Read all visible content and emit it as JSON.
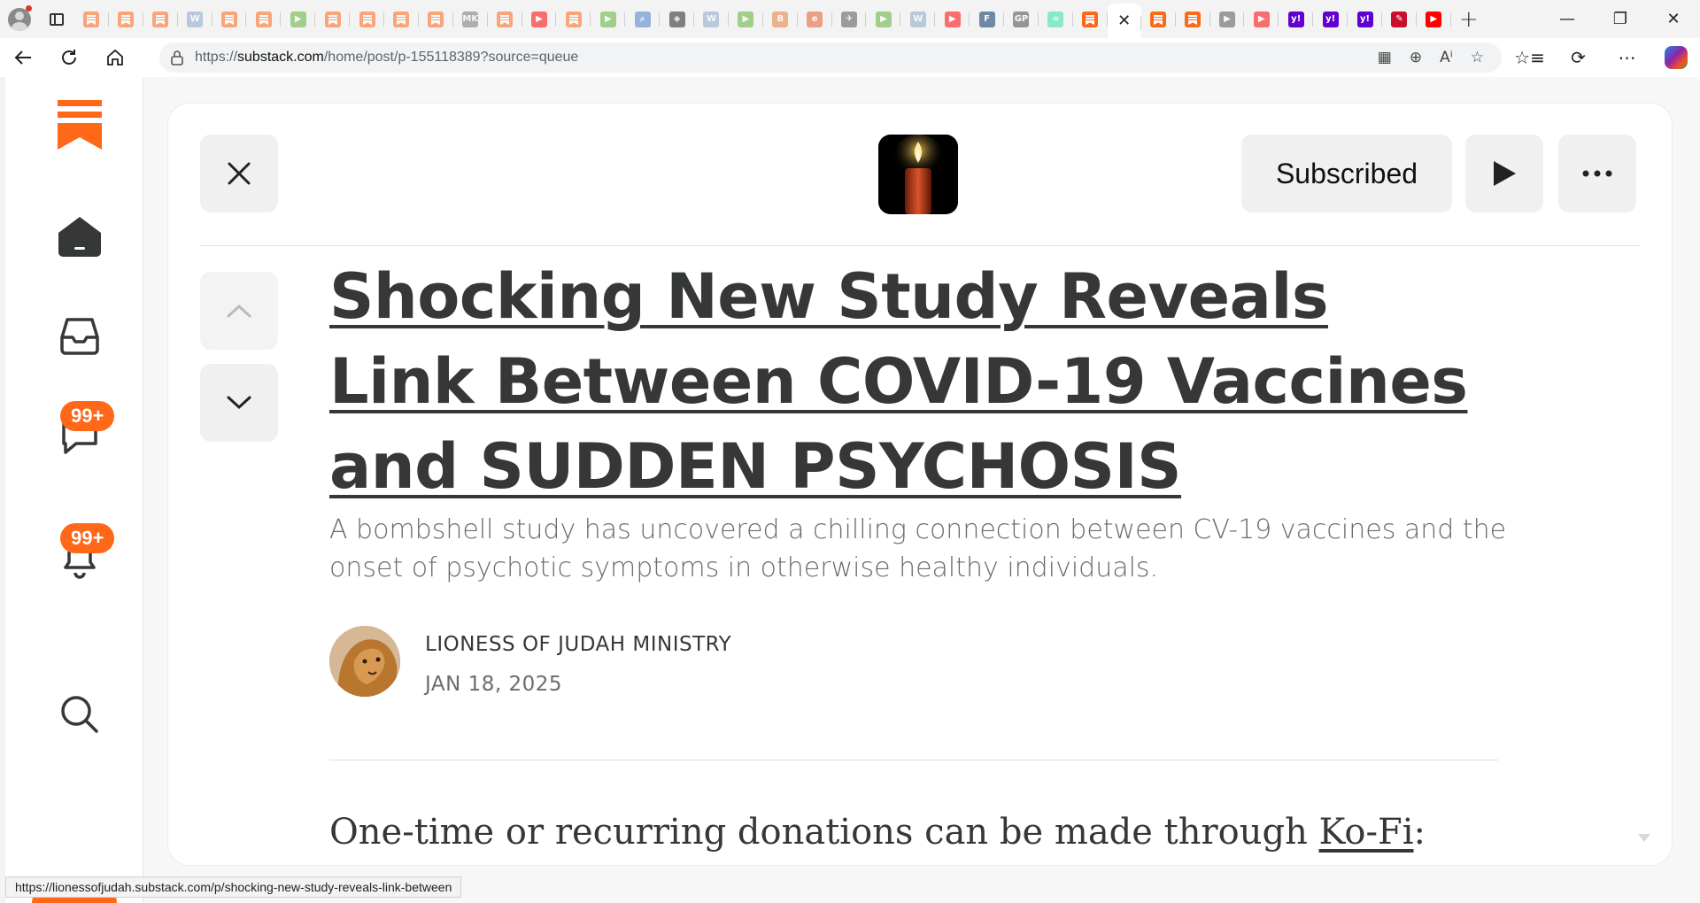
{
  "browser": {
    "tabs": [
      {
        "icon": "substack-icon",
        "color": "#ff6719",
        "glyph": ""
      },
      {
        "icon": "substack-icon",
        "color": "#ff6719",
        "glyph": ""
      },
      {
        "icon": "substack-icon",
        "color": "#ff6719",
        "glyph": ""
      },
      {
        "icon": "wikipedia-icon",
        "color": "#8aa6c8",
        "glyph": "W"
      },
      {
        "icon": "substack-icon",
        "color": "#ff6719",
        "glyph": ""
      },
      {
        "icon": "substack-icon",
        "color": "#ff6719",
        "glyph": ""
      },
      {
        "icon": "rumble-icon",
        "color": "#5cb335",
        "glyph": "▶"
      },
      {
        "icon": "substack-icon",
        "color": "#ff6719",
        "glyph": ""
      },
      {
        "icon": "substack-icon",
        "color": "#ff6719",
        "glyph": ""
      },
      {
        "icon": "substack-icon",
        "color": "#ff6719",
        "glyph": ""
      },
      {
        "icon": "substack-icon",
        "color": "#ff6719",
        "glyph": ""
      },
      {
        "icon": "mk-icon",
        "color": "#777777",
        "glyph": "MK"
      },
      {
        "icon": "substack-icon",
        "color": "#ff6719",
        "glyph": ""
      },
      {
        "icon": "youtube-icon",
        "color": "#ff0000",
        "glyph": "▶"
      },
      {
        "icon": "substack-icon",
        "color": "#ff6719",
        "glyph": ""
      },
      {
        "icon": "rumble-icon",
        "color": "#5cb335",
        "glyph": "▶"
      },
      {
        "icon": "search-icon",
        "color": "#4a7fc4",
        "glyph": "⌕"
      },
      {
        "icon": "navigation-icon",
        "color": "#222222",
        "glyph": "◈"
      },
      {
        "icon": "wikipedia-icon",
        "color": "#8aa6c8",
        "glyph": "W"
      },
      {
        "icon": "rumble-icon",
        "color": "#5cb335",
        "glyph": "▶"
      },
      {
        "icon": "bookmark-icon",
        "color": "#e57c3a",
        "glyph": "B"
      },
      {
        "icon": "edge-e-icon",
        "color": "#e55b2b",
        "glyph": "e"
      },
      {
        "icon": "bird-icon",
        "color": "#555555",
        "glyph": "✈"
      },
      {
        "icon": "rumble-icon",
        "color": "#5cb335",
        "glyph": "▶"
      },
      {
        "icon": "wikipedia-icon",
        "color": "#8aa6c8",
        "glyph": "W"
      },
      {
        "icon": "youtube-icon",
        "color": "#ff0000",
        "glyph": "▶"
      },
      {
        "icon": "fox-news-icon",
        "color": "#003366",
        "glyph": "F"
      },
      {
        "icon": "gp-icon",
        "color": "#4a4a4a",
        "glyph": "GP"
      },
      {
        "icon": "tripadvisor-icon",
        "color": "#34e0a1",
        "glyph": "∞"
      },
      {
        "icon": "substack-icon",
        "color": "#ff6719",
        "glyph": "",
        "bright": true
      },
      {
        "icon": "close-icon",
        "color": "",
        "glyph": "✕",
        "active": true
      },
      {
        "icon": "substack-icon",
        "color": "#ff6719",
        "glyph": "",
        "bright": true
      },
      {
        "icon": "substack-icon",
        "color": "#ff6719",
        "glyph": "",
        "bright": true
      },
      {
        "icon": "forward-tag-icon",
        "color": "#555555",
        "glyph": "▶"
      },
      {
        "icon": "youtube-icon",
        "color": "#ff0000",
        "glyph": "▶"
      },
      {
        "icon": "yahoo-icon",
        "color": "#6001d2",
        "glyph": "y!",
        "bright": true
      },
      {
        "icon": "yahoo-icon",
        "color": "#6001d2",
        "glyph": "y!",
        "bright": true
      },
      {
        "icon": "yahoo-icon",
        "color": "#6001d2",
        "glyph": "y!",
        "bright": true
      },
      {
        "icon": "pen-icon",
        "color": "#c8102e",
        "glyph": "✎",
        "bright": true
      },
      {
        "icon": "youtube-icon",
        "color": "#ff0000",
        "glyph": "▶",
        "bright": true
      }
    ],
    "url_prefix": "https://",
    "url_domain": "substack.com",
    "url_path": "/home/post/p-155118389?source=queue",
    "status_url": "https://lionessofjudah.substack.com/p/shocking-new-study-reveals-link-between"
  },
  "rail": {
    "brand_color": "#ff6719",
    "chat_badge": "99+",
    "notifications_badge": "99+"
  },
  "post": {
    "subscribe_label": "Subscribed",
    "title": "Shocking New Study Reveals Link Between COVID-19 Vaccines and SUDDEN PSYCHOSIS",
    "subtitle": "A bombshell study has uncovered a chilling connection between CV-19 vaccines and the onset of psychotic symptoms in otherwise healthy individuals.",
    "author": "LIONESS OF JUDAH MINISTRY",
    "date": "JAN 18, 2025",
    "donate_text": "One-time or recurring donations can be made through ",
    "donate_link": "Ko-Fi",
    "donate_suffix": ":"
  }
}
